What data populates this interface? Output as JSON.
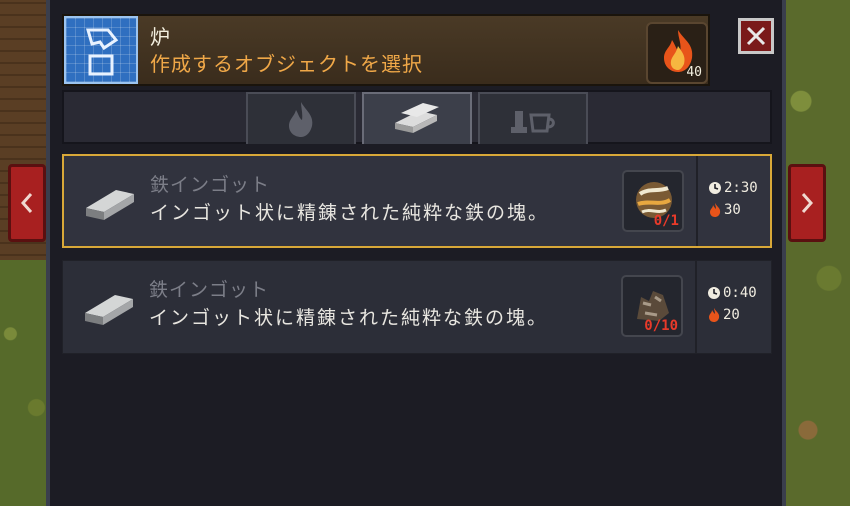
{
  "window": {
    "title": "炉",
    "subtitle": "作成するオブジェクトを選択",
    "fuel_amount": "40",
    "icons": {
      "blueprint": "blueprint-icon",
      "fuel": "fire-icon",
      "close": "close-icon"
    }
  },
  "tabs": [
    {
      "icon": "fire-tab-icon",
      "active": false
    },
    {
      "icon": "ingot-tab-icon",
      "active": true
    },
    {
      "icon": "tools-tab-icon",
      "active": false
    }
  ],
  "recipes": [
    {
      "name": "鉄インゴット",
      "description": "インゴット状に精錬された純粋な鉄の塊。",
      "ingredient_count": "0/1",
      "time": "2:30",
      "fuel": "30",
      "selected": true
    },
    {
      "name": "鉄インゴット",
      "description": "インゴット状に精錬された純粋な鉄の塊。",
      "ingredient_count": "0/10",
      "time": "0:40",
      "fuel": "20",
      "selected": false
    }
  ],
  "colors": {
    "accent_gold": "#d8a838",
    "subtitle_orange": "#f0a848",
    "count_red": "#e83a2a",
    "nav_red": "#a82020"
  }
}
